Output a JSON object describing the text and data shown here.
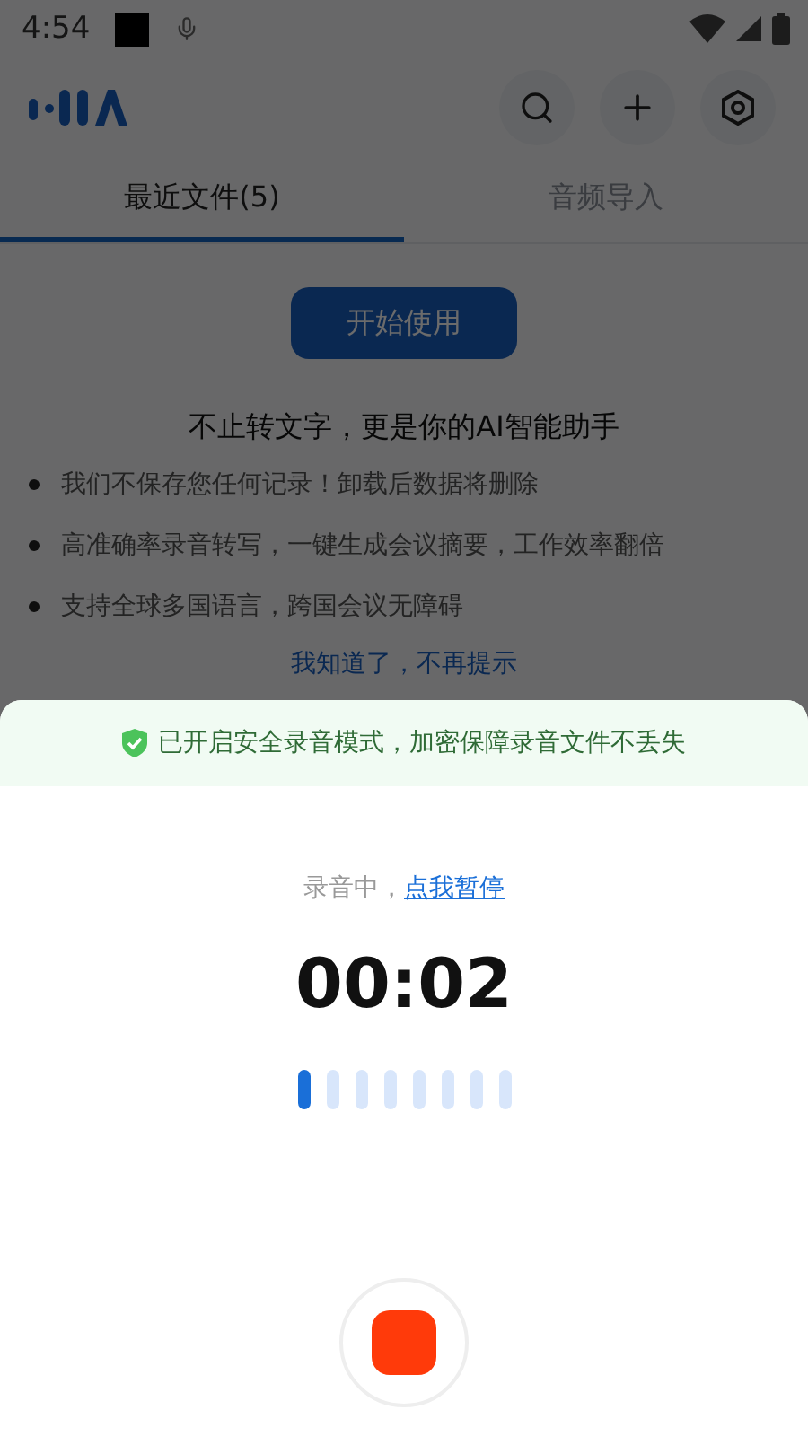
{
  "status_bar": {
    "time": "4:54"
  },
  "tabs": [
    {
      "label": "最近文件(5)",
      "selected": true
    },
    {
      "label": "音频导入",
      "selected": false
    }
  ],
  "start_button": "开始使用",
  "intro": {
    "title": "不止转文字，更是你的AI智能助手",
    "points": [
      "我们不保存您任何记录！卸载后数据将删除",
      "高准确率录音转写，一键生成会议摘要，工作效率翻倍",
      "支持全球多国语言，跨国会议无障碍"
    ],
    "dismiss_link": "我知道了，不再提示"
  },
  "recording_sheet": {
    "banner": "已开启安全录音模式，加密保障录音文件不丢失",
    "status": "录音中，",
    "pause_link": "点我暂停",
    "timer": "00:02",
    "bars": [
      {
        "on": true
      },
      {
        "on": false
      },
      {
        "on": false
      },
      {
        "on": false
      },
      {
        "on": false
      },
      {
        "on": false
      },
      {
        "on": false
      },
      {
        "on": false
      }
    ]
  }
}
